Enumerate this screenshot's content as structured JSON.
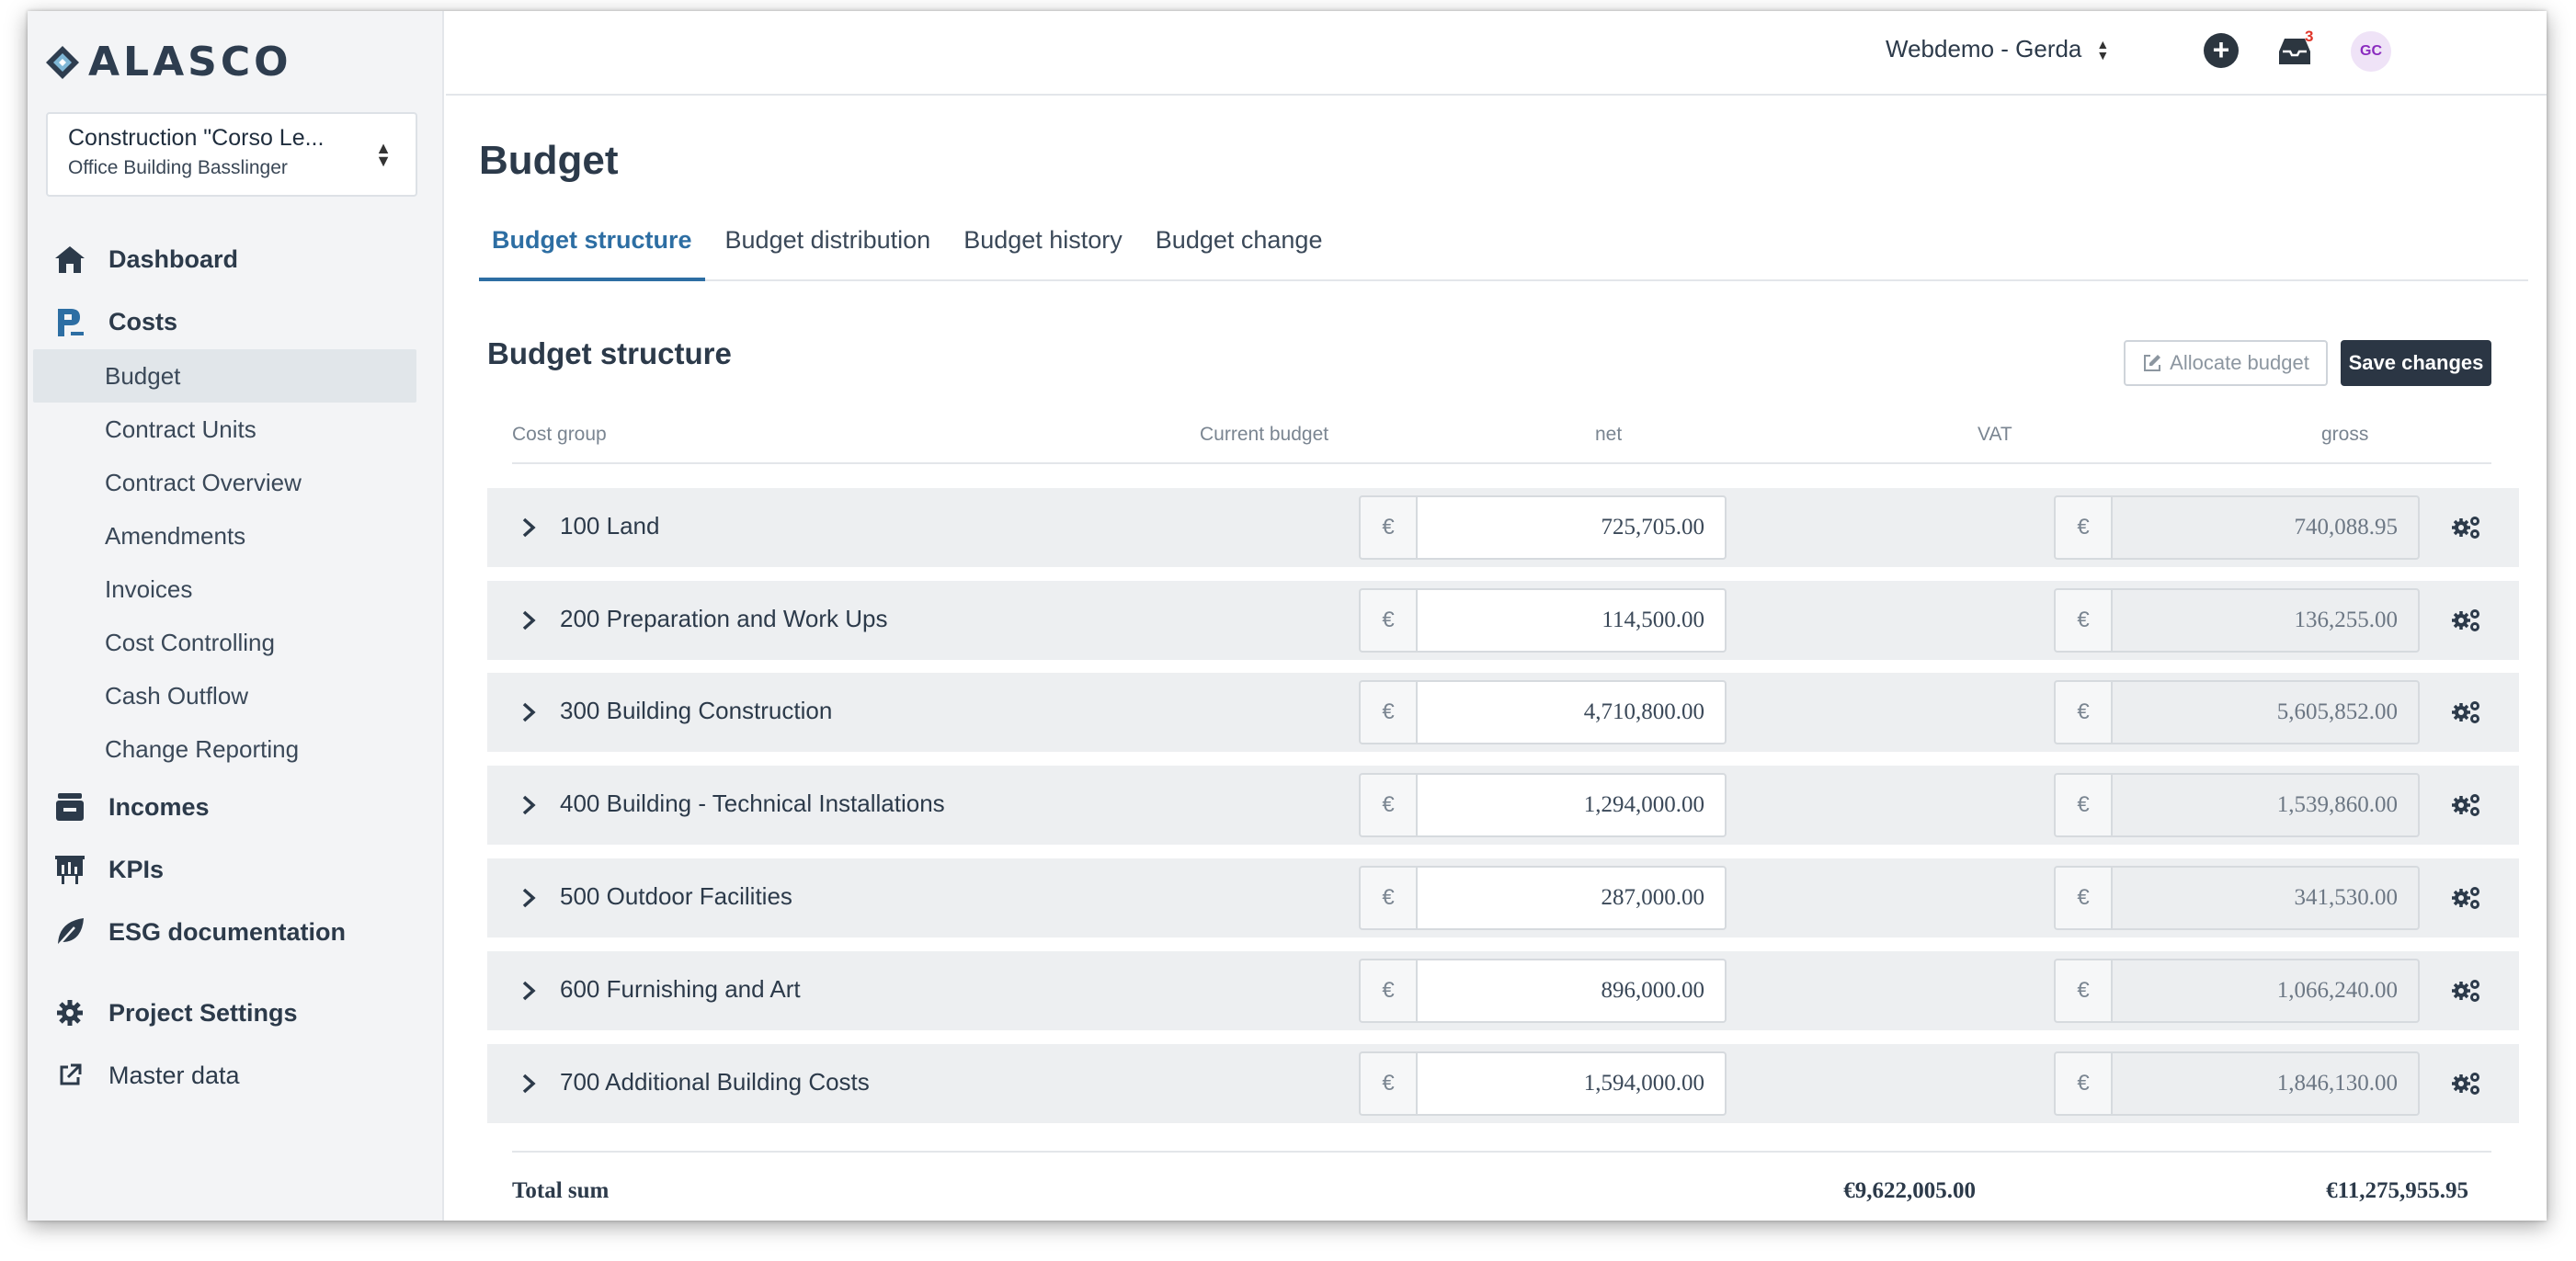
{
  "app": {
    "logo_text": "ALASCO"
  },
  "project": {
    "name": "Construction \"Corso Le...",
    "subtitle": "Office Building Basslinger"
  },
  "sidebar": {
    "dashboard": "Dashboard",
    "costs": "Costs",
    "costs_items": [
      "Budget",
      "Contract Units",
      "Contract Overview",
      "Amendments",
      "Invoices",
      "Cost Controlling",
      "Cash Outflow",
      "Change Reporting"
    ],
    "incomes": "Incomes",
    "kpis": "KPIs",
    "esg": "ESG documentation",
    "project_settings": "Project Settings",
    "master_data": "Master data"
  },
  "header": {
    "user": "Webdemo - Gerda",
    "notification_count": "3",
    "avatar_initials": "GC"
  },
  "page": {
    "title": "Budget",
    "tabs": [
      "Budget structure",
      "Budget distribution",
      "Budget history",
      "Budget change"
    ],
    "active_tab": 0
  },
  "budget_structure": {
    "title": "Budget structure",
    "allocate_label": "Allocate budget",
    "save_label": "Save changes",
    "columns": {
      "cost_group": "Cost group",
      "current_budget": "Current budget",
      "net": "net",
      "vat": "VAT",
      "gross": "gross"
    },
    "currency_symbol": "€",
    "rows": [
      {
        "label": "100 Land",
        "net": "725,705.00",
        "gross": "740,088.95"
      },
      {
        "label": "200 Preparation and Work Ups",
        "net": "114,500.00",
        "gross": "136,255.00"
      },
      {
        "label": "300 Building Construction",
        "net": "4,710,800.00",
        "gross": "5,605,852.00"
      },
      {
        "label": "400 Building - Technical Installations",
        "net": "1,294,000.00",
        "gross": "1,539,860.00"
      },
      {
        "label": "500 Outdoor Facilities",
        "net": "287,000.00",
        "gross": "341,530.00"
      },
      {
        "label": "600 Furnishing and Art",
        "net": "896,000.00",
        "gross": "1,066,240.00"
      },
      {
        "label": "700 Additional Building Costs",
        "net": "1,594,000.00",
        "gross": "1,846,130.00"
      }
    ],
    "total": {
      "label": "Total sum",
      "net": "€9,622,005.00",
      "gross": "€11,275,955.95"
    }
  },
  "colors": {
    "accent": "#2d6ea3",
    "primary_button": "#2b3644",
    "sidebar_bg": "#f3f4f6",
    "row_bg": "#edeff1",
    "badge": "#e0362a"
  }
}
